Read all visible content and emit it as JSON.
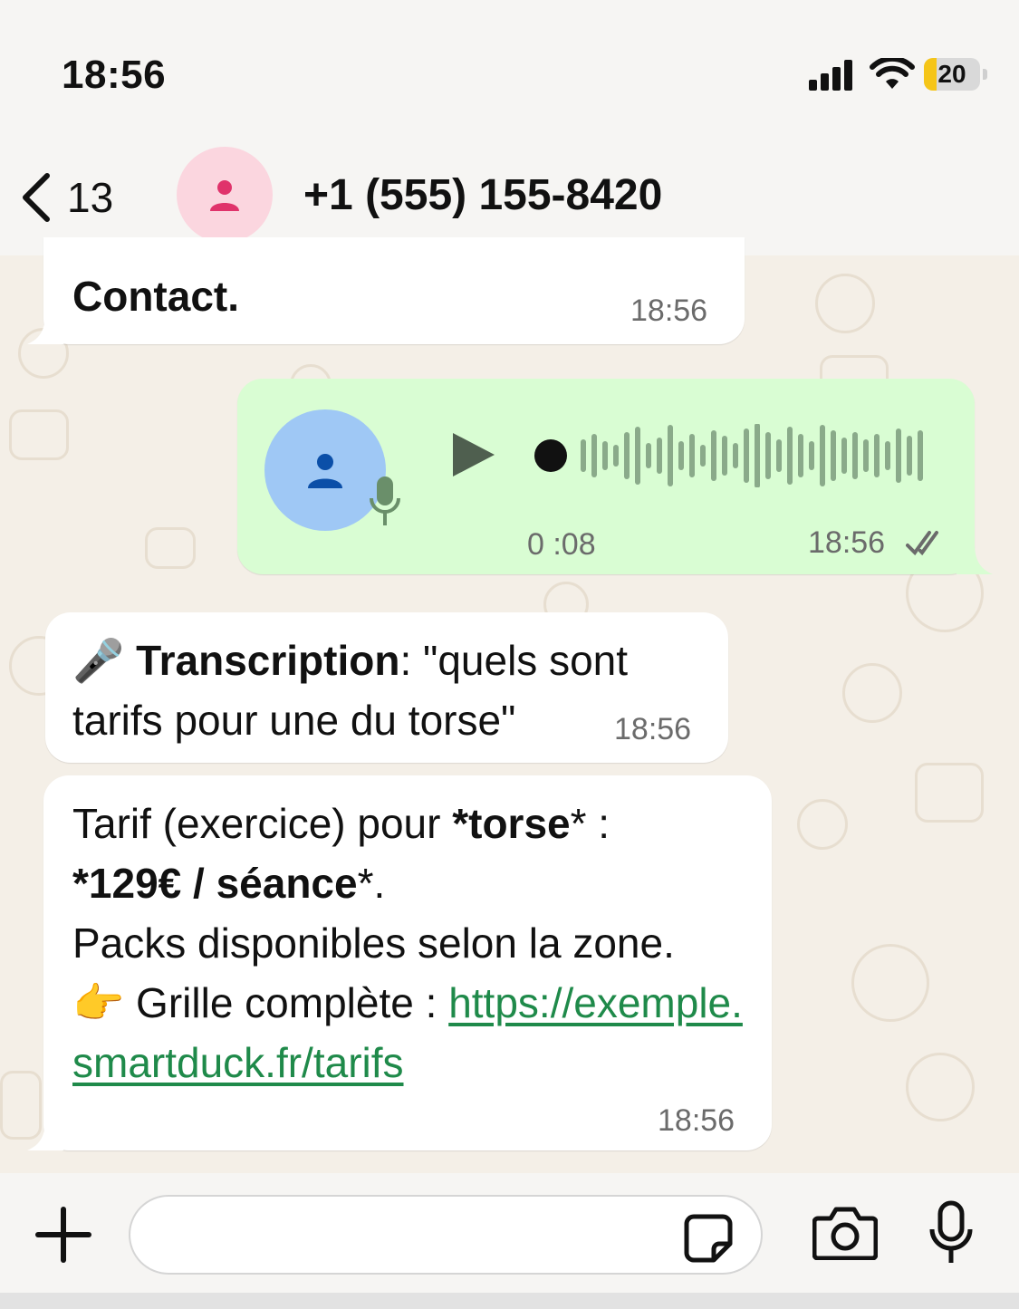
{
  "status": {
    "time": "18:56",
    "battery": "20"
  },
  "header": {
    "back_count": "13",
    "contact": "+1 (555) 155-8420"
  },
  "messages": {
    "m1": {
      "text": "Contact.",
      "time": "18:56"
    },
    "voice": {
      "duration": "0 :08",
      "time": "18:56"
    },
    "transcription": {
      "emoji": "🎤",
      "label": "Transcription",
      "body": ": \"quels sont tarifs pour une du torse\"",
      "time": "18:56"
    },
    "reply": {
      "l1_pre": "Tarif (exercice) pour ",
      "l1_bold": "*torse",
      "l1_post": "* :",
      "l2_bold": "*129€ / séance",
      "l2_post": "*.",
      "l3": "Packs disponibles selon la zone.",
      "l4_emoji": "👉",
      "l4_text": " Grille complète : ",
      "link": "https://exemple.smartduck.fr/tarifs",
      "time": "18:56"
    }
  },
  "colors": {
    "outgoing": "#d9fdd3",
    "incoming": "#ffffff",
    "link": "#1f8a4a",
    "battery": "#f5c518"
  }
}
